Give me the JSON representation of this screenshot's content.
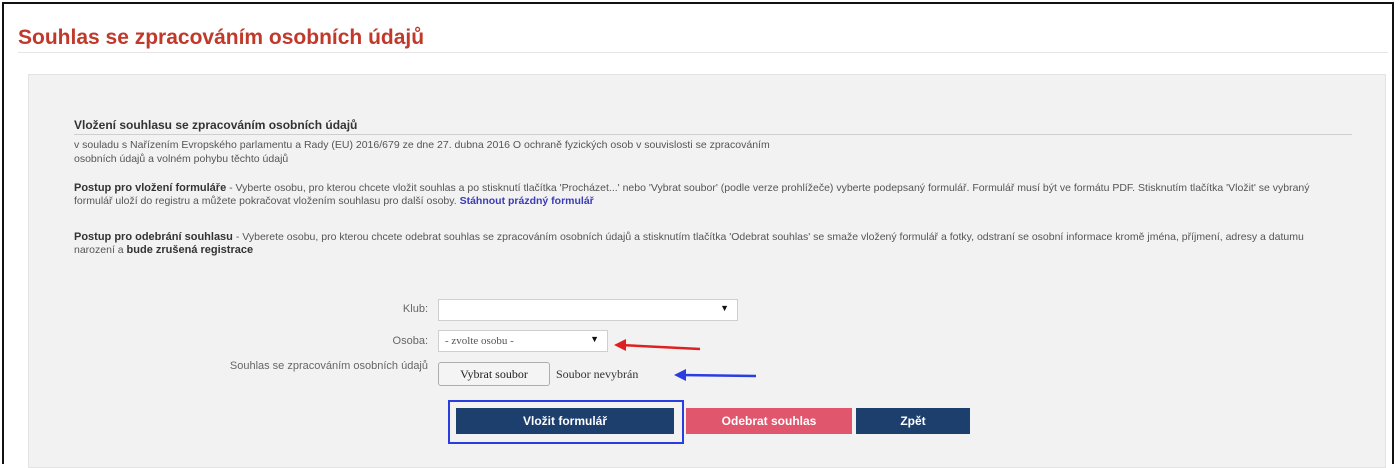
{
  "page": {
    "title": "Souhlas se zpracováním osobních údajů"
  },
  "section": {
    "heading": "Vložení souhlasu se zpracováním osobních údajů",
    "intro_line1": "v souladu s Nařízením Evropského parlamentu a Rady (EU) 2016/679 ze dne 27. dubna 2016 O ochraně fyzických osob v souvislosti se zpracováním",
    "intro_line2": "osobních údajů a volném pohybu těchto údajů"
  },
  "instructions": {
    "insert_title": "Postup pro vložení formuláře",
    "insert_text": " - Vyberte osobu, pro kterou chcete vložit souhlas a po stisknutí tlačítka 'Procházet...' nebo 'Vybrat soubor' (podle verze prohlížeče) vyberte podepsaný formulář. Formulář musí být ve formátu PDF. Stisknutím tlačítka 'Vložit' se vybraný formulář uloží do registru a můžete pokračovat vložením souhlasu pro další osoby. ",
    "download_link": "Stáhnout prázdný formulář",
    "remove_title": "Postup pro odebrání souhlasu",
    "remove_text": " - Vyberete osobu, pro kterou chcete odebrat souhlas se zpracováním osobních údajů a stisknutím tlačítka 'Odebrat souhlas' se smaže vložený formulář a fotky, odstraní se osobní informace kromě jména, příjmení, adresy a datumu narození a ",
    "remove_bold_end": "bude zrušená registrace"
  },
  "form": {
    "klub_label": "Klub:",
    "klub_value": "",
    "osoba_label": "Osoba:",
    "osoba_value": "- zvolte osobu -",
    "souhlas_label": "Souhlas se zpracováním osobních údajů",
    "file_button": "Vybrat soubor",
    "file_status": "Soubor nevybrán"
  },
  "buttons": {
    "insert": "Vložit formulář",
    "remove": "Odebrat souhlas",
    "back": "Zpět"
  },
  "colors": {
    "title": "#c0392b",
    "primary_button": "#1d3f6e",
    "danger_button": "#e0566c",
    "annotation_red": "#e02020",
    "annotation_blue": "#2a3de0"
  }
}
